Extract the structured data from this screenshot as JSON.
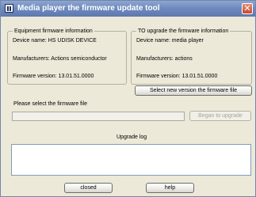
{
  "window": {
    "title": "Media player the firmware update tool",
    "close_glyph": "✕"
  },
  "equipment": {
    "legend": "Equipment firmware information",
    "device_name": "Device name: HS UDISK DEVICE",
    "manufacturer": "Manufacturers: Actions semiconductor",
    "firmware_version": "Firmware version: 13.01.51.0000"
  },
  "upgrade": {
    "legend": "TO upgrade the firmware information",
    "device_name": "Device name: media player",
    "manufacturer": "Manufacturers: actions",
    "firmware_version": "Firmware version: 13.01.51.0000"
  },
  "select_file_button": "Select new version the firmware file",
  "select_prompt": "Please select the firmware file",
  "file_path_value": "",
  "upgrade_button": "Began to upgrade",
  "log": {
    "title": "Upgrade log",
    "content": ""
  },
  "closed_button": "closed",
  "help_button": "help"
}
